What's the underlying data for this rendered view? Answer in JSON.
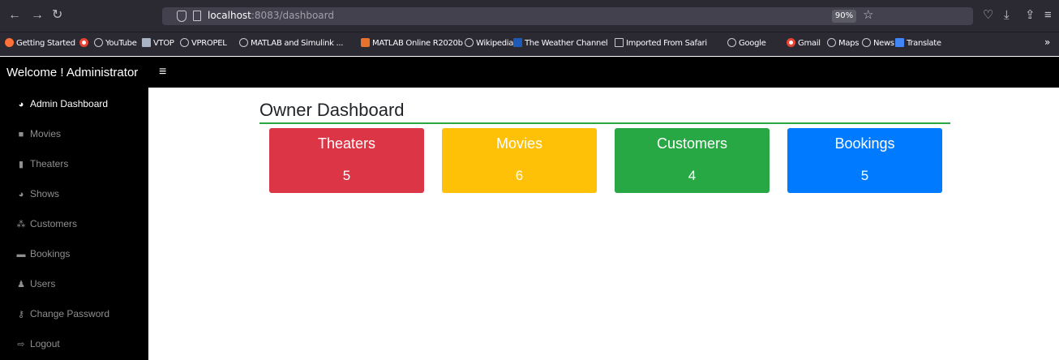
{
  "browser": {
    "url_host": "localhost",
    "url_path": ":8083/dashboard",
    "zoom": "90%",
    "bookmarks": [
      {
        "label": "Getting Started",
        "icon": "firefox-icon"
      },
      {
        "label": "",
        "icon": "google-icon"
      },
      {
        "label": "YouTube",
        "icon": "globe-icon"
      },
      {
        "label": "VTOP",
        "icon": "vtop-icon"
      },
      {
        "label": "VPROPEL",
        "icon": "globe-icon"
      },
      {
        "label": "MATLAB and Simulink ...",
        "icon": "globe-icon"
      },
      {
        "label": "MATLAB Online R2020b",
        "icon": "matlab-icon"
      },
      {
        "label": "Wikipedia",
        "icon": "globe-icon"
      },
      {
        "label": "The Weather Channel",
        "icon": "weather-icon"
      },
      {
        "label": "Imported From Safari",
        "icon": "folder-icon"
      },
      {
        "label": "Google",
        "icon": "globe-icon"
      },
      {
        "label": "Gmail",
        "icon": "google-icon"
      },
      {
        "label": "Maps",
        "icon": "globe-icon"
      },
      {
        "label": "News",
        "icon": "globe-icon"
      },
      {
        "label": "Translate",
        "icon": "translate-icon"
      }
    ]
  },
  "header": {
    "title": "Welcome ! Administrator",
    "menu_icon": "≡"
  },
  "sidebar": {
    "items": [
      {
        "label": "Admin Dashboard",
        "icon": "tachometer-icon",
        "active": true
      },
      {
        "label": "Movies",
        "icon": "video-icon",
        "active": false
      },
      {
        "label": "Theaters",
        "icon": "building-icon",
        "active": false
      },
      {
        "label": "Shows",
        "icon": "tachometer-icon",
        "active": false
      },
      {
        "label": "Customers",
        "icon": "users-icon",
        "active": false
      },
      {
        "label": "Bookings",
        "icon": "ticket-icon",
        "active": false
      },
      {
        "label": "Users",
        "icon": "user-icon",
        "active": false
      },
      {
        "label": "Change Password",
        "icon": "key-icon",
        "active": false
      },
      {
        "label": "Logout",
        "icon": "sign-out-icon",
        "active": false
      }
    ]
  },
  "main": {
    "title": "Owner Dashboard",
    "cards": [
      {
        "title": "Theaters",
        "value": "5",
        "color": "#dc3545"
      },
      {
        "title": "Movies",
        "value": "6",
        "color": "#ffc107"
      },
      {
        "title": "Customers",
        "value": "4",
        "color": "#28a745"
      },
      {
        "title": "Bookings",
        "value": "5",
        "color": "#007bff"
      }
    ]
  }
}
